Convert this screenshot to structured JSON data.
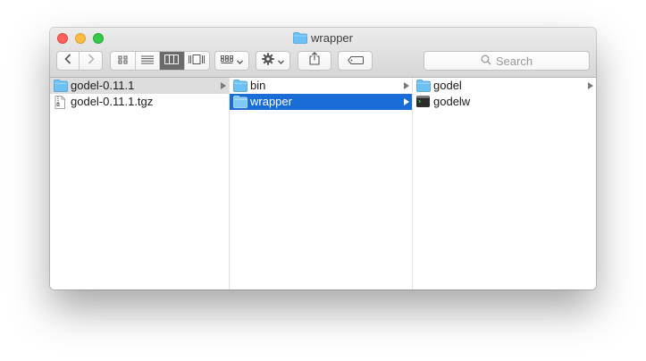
{
  "window": {
    "title": "wrapper"
  },
  "toolbar": {
    "search_placeholder": "Search",
    "back_icon": "chevron-left-icon",
    "forward_icon": "chevron-right-icon",
    "view_modes": [
      "icon-view",
      "list-view",
      "column-view",
      "cover-flow-view"
    ],
    "active_view": "column-view"
  },
  "columns": [
    {
      "items": [
        {
          "label": "godel-0.11.1",
          "icon": "folder-icon",
          "has_children": true,
          "state": "selected-inactive"
        },
        {
          "label": "godel-0.11.1.tgz",
          "icon": "archive-file-icon",
          "has_children": false,
          "state": "none"
        }
      ]
    },
    {
      "items": [
        {
          "label": "bin",
          "icon": "folder-icon",
          "has_children": true,
          "state": "none"
        },
        {
          "label": "wrapper",
          "icon": "folder-icon",
          "has_children": true,
          "state": "selected-active"
        }
      ]
    },
    {
      "items": [
        {
          "label": "godel",
          "icon": "folder-icon",
          "has_children": true,
          "state": "none"
        },
        {
          "label": "godelw",
          "icon": "terminal-executable-icon",
          "has_children": false,
          "state": "none"
        }
      ]
    }
  ],
  "colors": {
    "selection_active": "#1a6dd6",
    "selection_inactive": "#dcdcdc",
    "folder": "#6cc0f2"
  }
}
